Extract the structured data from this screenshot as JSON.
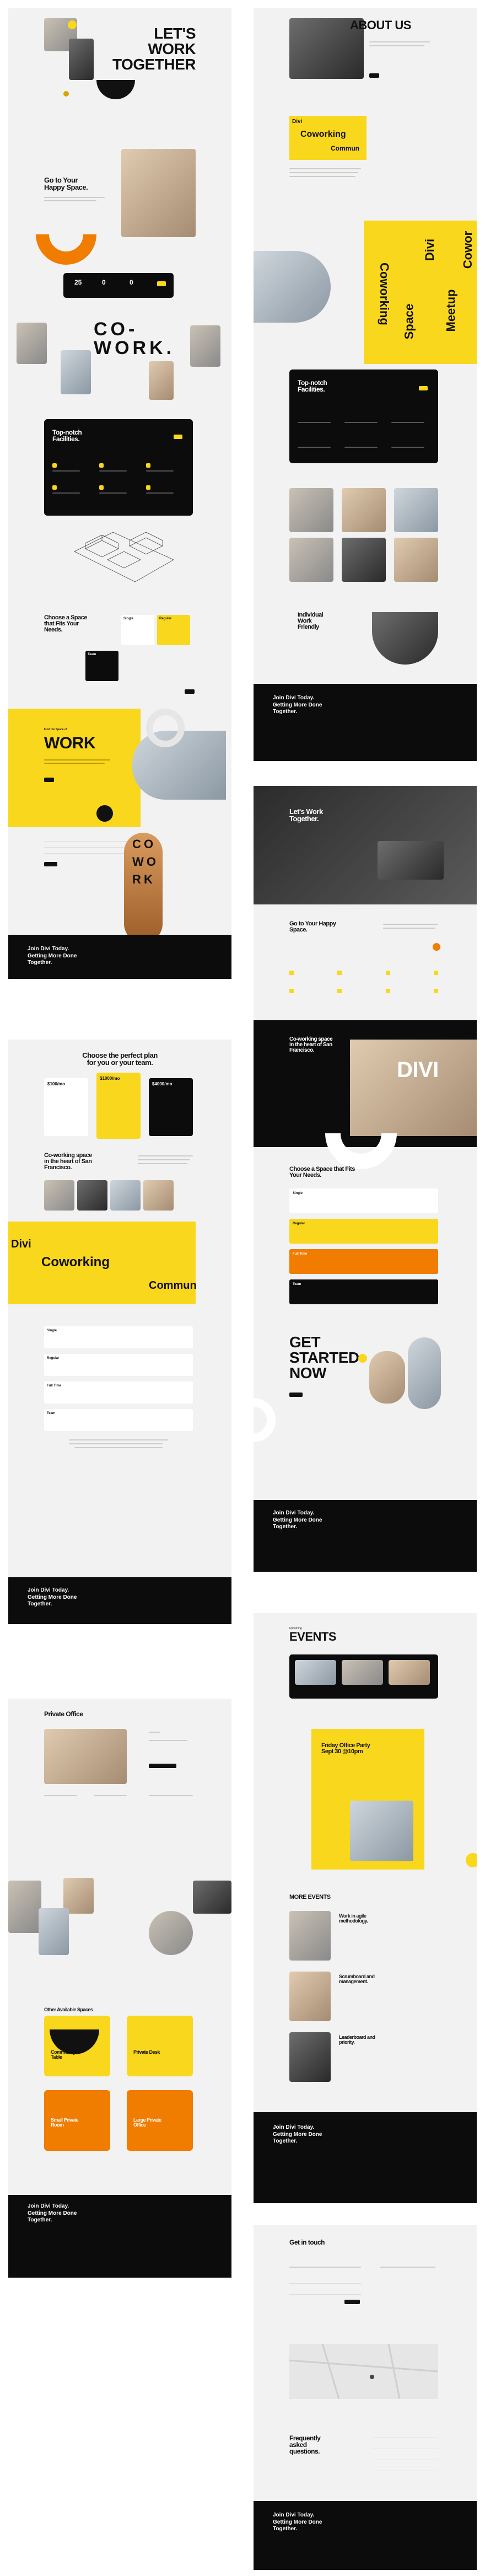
{
  "col1": {
    "hero": {
      "title_lines": [
        "LET'S",
        "WORK",
        "TOGETHER"
      ]
    },
    "happy": {
      "title_lines": [
        "Go to Your",
        "Happy Space."
      ]
    },
    "stats": [
      {
        "value": "25"
      },
      {
        "value": "0"
      },
      {
        "value": "0"
      }
    ],
    "cowork": {
      "line1": "CO-",
      "line2": "WORK."
    },
    "facilities": {
      "title_lines": [
        "Top-notch",
        "Facilities."
      ]
    },
    "choose": {
      "title_lines": [
        "Choose a Space",
        "that Fits Your",
        "Needs."
      ]
    },
    "plans": [
      {
        "name": "Single"
      },
      {
        "name": "Regular"
      },
      {
        "name": "Team"
      }
    ],
    "work": {
      "small": "Find the Space of",
      "big": "WORK"
    },
    "cowork_vertical": {
      "line1": "C  O",
      "line2": "W  O",
      "line3": "R  K"
    },
    "footer1": {
      "title_lines": [
        "Join Divi Today.",
        "Getting More Done",
        "Together."
      ]
    }
  },
  "pricing": {
    "title_lines": [
      "Choose the perfect plan",
      "for you or your team."
    ],
    "plans": [
      {
        "price": "$100/mo"
      },
      {
        "price": "$1000/mo"
      },
      {
        "price": "$4000/mo"
      }
    ],
    "sf": {
      "title_lines": [
        "Co-working space",
        "in the heart of San",
        "Francisco."
      ]
    },
    "divi": "Divi",
    "coworking": "Coworking",
    "commun": "Commun",
    "tiers": [
      {
        "name": "Single"
      },
      {
        "name": "Regular"
      },
      {
        "name": "Full Time"
      },
      {
        "name": "Team"
      }
    ],
    "footer": {
      "title_lines": [
        "Join Divi Today.",
        "Getting More Done",
        "Together."
      ]
    }
  },
  "office": {
    "title": "Private Office",
    "other": "Other Available Spaces",
    "tiles": [
      {
        "lines": [
          "Community",
          "Table"
        ]
      },
      {
        "lines": [
          "Private Desk"
        ]
      },
      {
        "lines": [
          "Small Private",
          "Room"
        ]
      },
      {
        "lines": [
          "Large Private",
          "Office"
        ]
      }
    ],
    "footer": {
      "title_lines": [
        "Join Divi Today.",
        "Getting More Done",
        "Together."
      ]
    }
  },
  "about": {
    "title": "ABOUT US",
    "divi": "Divi",
    "coworking": "Coworking",
    "commun": "Commun",
    "vertical": [
      "Coworking",
      "Divi",
      "Space",
      "Meetup",
      "Cowor"
    ],
    "facilities": {
      "title_lines": [
        "Top-notch",
        "Facilities."
      ]
    },
    "friendly": {
      "title_lines": [
        "Individual",
        "Work",
        "Friendly"
      ]
    },
    "footer": {
      "title_lines": [
        "Join Divi Today.",
        "Getting More Done",
        "Together."
      ]
    }
  },
  "home2": {
    "hero": {
      "title_lines": [
        "Let's Work",
        "Together."
      ]
    },
    "happy": {
      "title_lines": [
        "Go to Your Happy",
        "Space."
      ]
    },
    "cowork_sf": {
      "title_lines": [
        "Co-working space",
        "in the heart of San",
        "Francisco."
      ]
    },
    "divi": "DIVI",
    "choose": {
      "title_lines": [
        "Choose a Space that Fits",
        "Your Needs."
      ]
    },
    "tiers": [
      {
        "name": "Single"
      },
      {
        "name": "Regular"
      },
      {
        "name": "Full Time"
      },
      {
        "name": "Team"
      }
    ],
    "get_started": {
      "title_lines": [
        "GET",
        "STARTED",
        "NOW"
      ]
    },
    "footer": {
      "title_lines": [
        "Join Divi Today.",
        "Getting More Done",
        "Together."
      ]
    }
  },
  "events": {
    "small": "Upcoming",
    "title": "EVENTS",
    "party": {
      "title_lines": [
        "Friday Office Party",
        "Sept 30 @10pm"
      ]
    },
    "more": "MORE EVENTS",
    "items": [
      {
        "title_lines": [
          "Work in agile",
          "methodology."
        ]
      },
      {
        "title_lines": [
          "Scrumboard and",
          "management."
        ]
      },
      {
        "title_lines": [
          "Leaderboard and",
          "priority."
        ]
      }
    ],
    "footer": {
      "title_lines": [
        "Join Divi Today.",
        "Getting More Done",
        "Together."
      ]
    }
  },
  "contact": {
    "title": "Get in touch",
    "faq": {
      "title_lines": [
        "Frequently",
        "asked",
        "questions."
      ]
    },
    "footer": {
      "title_lines": [
        "Join Divi Today.",
        "Getting More Done",
        "Together."
      ]
    }
  },
  "colors": {
    "yellow": "#f9d71c",
    "orange": "#f07c00",
    "black": "#0c0c0c",
    "card": "#f2f2f2"
  }
}
